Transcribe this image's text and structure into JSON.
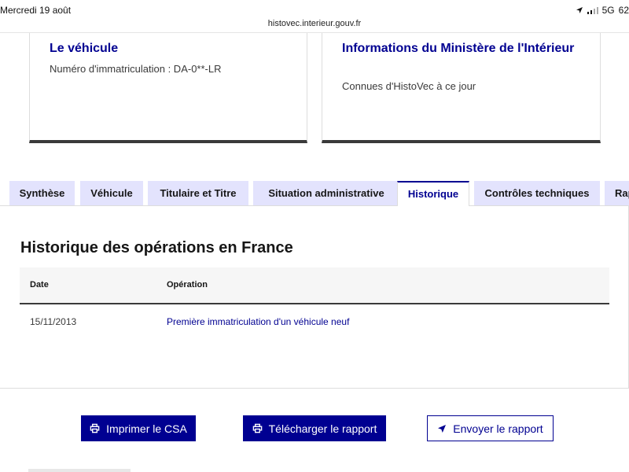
{
  "status_bar": {
    "date": "Mercredi 19 août",
    "network": "5G",
    "battery": "62"
  },
  "browser": {
    "url": "histovec.interieur.gouv.fr"
  },
  "cards": [
    {
      "title": "Le véhicule",
      "subtitle": "Numéro d'immatriculation : DA-0**-LR"
    },
    {
      "title": "Informations du Ministère de l'Intérieur",
      "subtitle": "Connues d'HistoVec à ce jour"
    }
  ],
  "tabs": [
    {
      "label": "Synthèse",
      "active": false
    },
    {
      "label": "Véhicule",
      "active": false
    },
    {
      "label": "Titulaire et Titre",
      "active": false
    },
    {
      "label": "Situation administrative",
      "active": false
    },
    {
      "label": "Historique",
      "active": true
    },
    {
      "label": "Contrôles techniques",
      "active": false
    },
    {
      "label": "Rapport",
      "active": false
    }
  ],
  "history": {
    "title": "Historique des opérations en France",
    "columns": [
      "Date",
      "Opération"
    ],
    "rows": [
      {
        "date": "15/11/2013",
        "operation": "Première immatriculation d'un véhicule neuf"
      }
    ]
  },
  "actions": {
    "print_label": "Imprimer le CSA",
    "download_label": "Télécharger le rapport",
    "send_label": "Envoyer le rapport"
  },
  "colors": {
    "brand": "#000091",
    "tab_bg": "#e3e3fd"
  }
}
